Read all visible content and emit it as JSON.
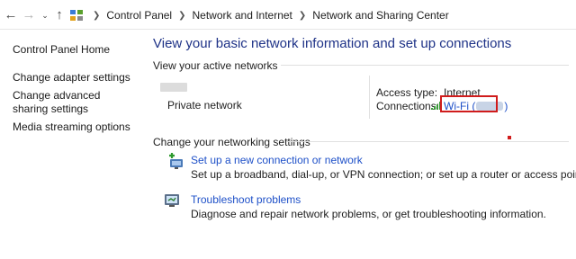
{
  "address_bar": {
    "back_icon": "arrow-left-icon",
    "forward_icon": "arrow-right-icon",
    "recent_icon": "chevron-down-icon",
    "up_icon": "arrow-up-icon",
    "crumbs": [
      "Control Panel",
      "Network and Internet",
      "Network and Sharing Center"
    ]
  },
  "sidebar": {
    "home": "Control Panel Home",
    "tasks": [
      "Change adapter settings",
      "Change advanced sharing settings",
      "Media streaming options"
    ]
  },
  "main": {
    "title": "View your basic network information and set up connections",
    "active_networks_header": "View your active networks",
    "network": {
      "category": "Private network",
      "access_type_label": "Access type:",
      "access_type_value": "Internet",
      "connections_label": "Connections:",
      "connection_prefix": "Wi-Fi (",
      "connection_suffix": ")"
    },
    "settings_header": "Change your networking settings",
    "tasks": [
      {
        "icon": "new-connection-icon",
        "link": "Set up a new connection or network",
        "desc": "Set up a broadband, dial-up, or VPN connection; or set up a router or access point."
      },
      {
        "icon": "troubleshoot-icon",
        "link": "Troubleshoot problems",
        "desc": "Diagnose and repair network problems, or get troubleshooting information."
      }
    ]
  },
  "colors": {
    "title": "#1e3287",
    "link": "#1e50c8",
    "highlight": "#d01c1c"
  }
}
